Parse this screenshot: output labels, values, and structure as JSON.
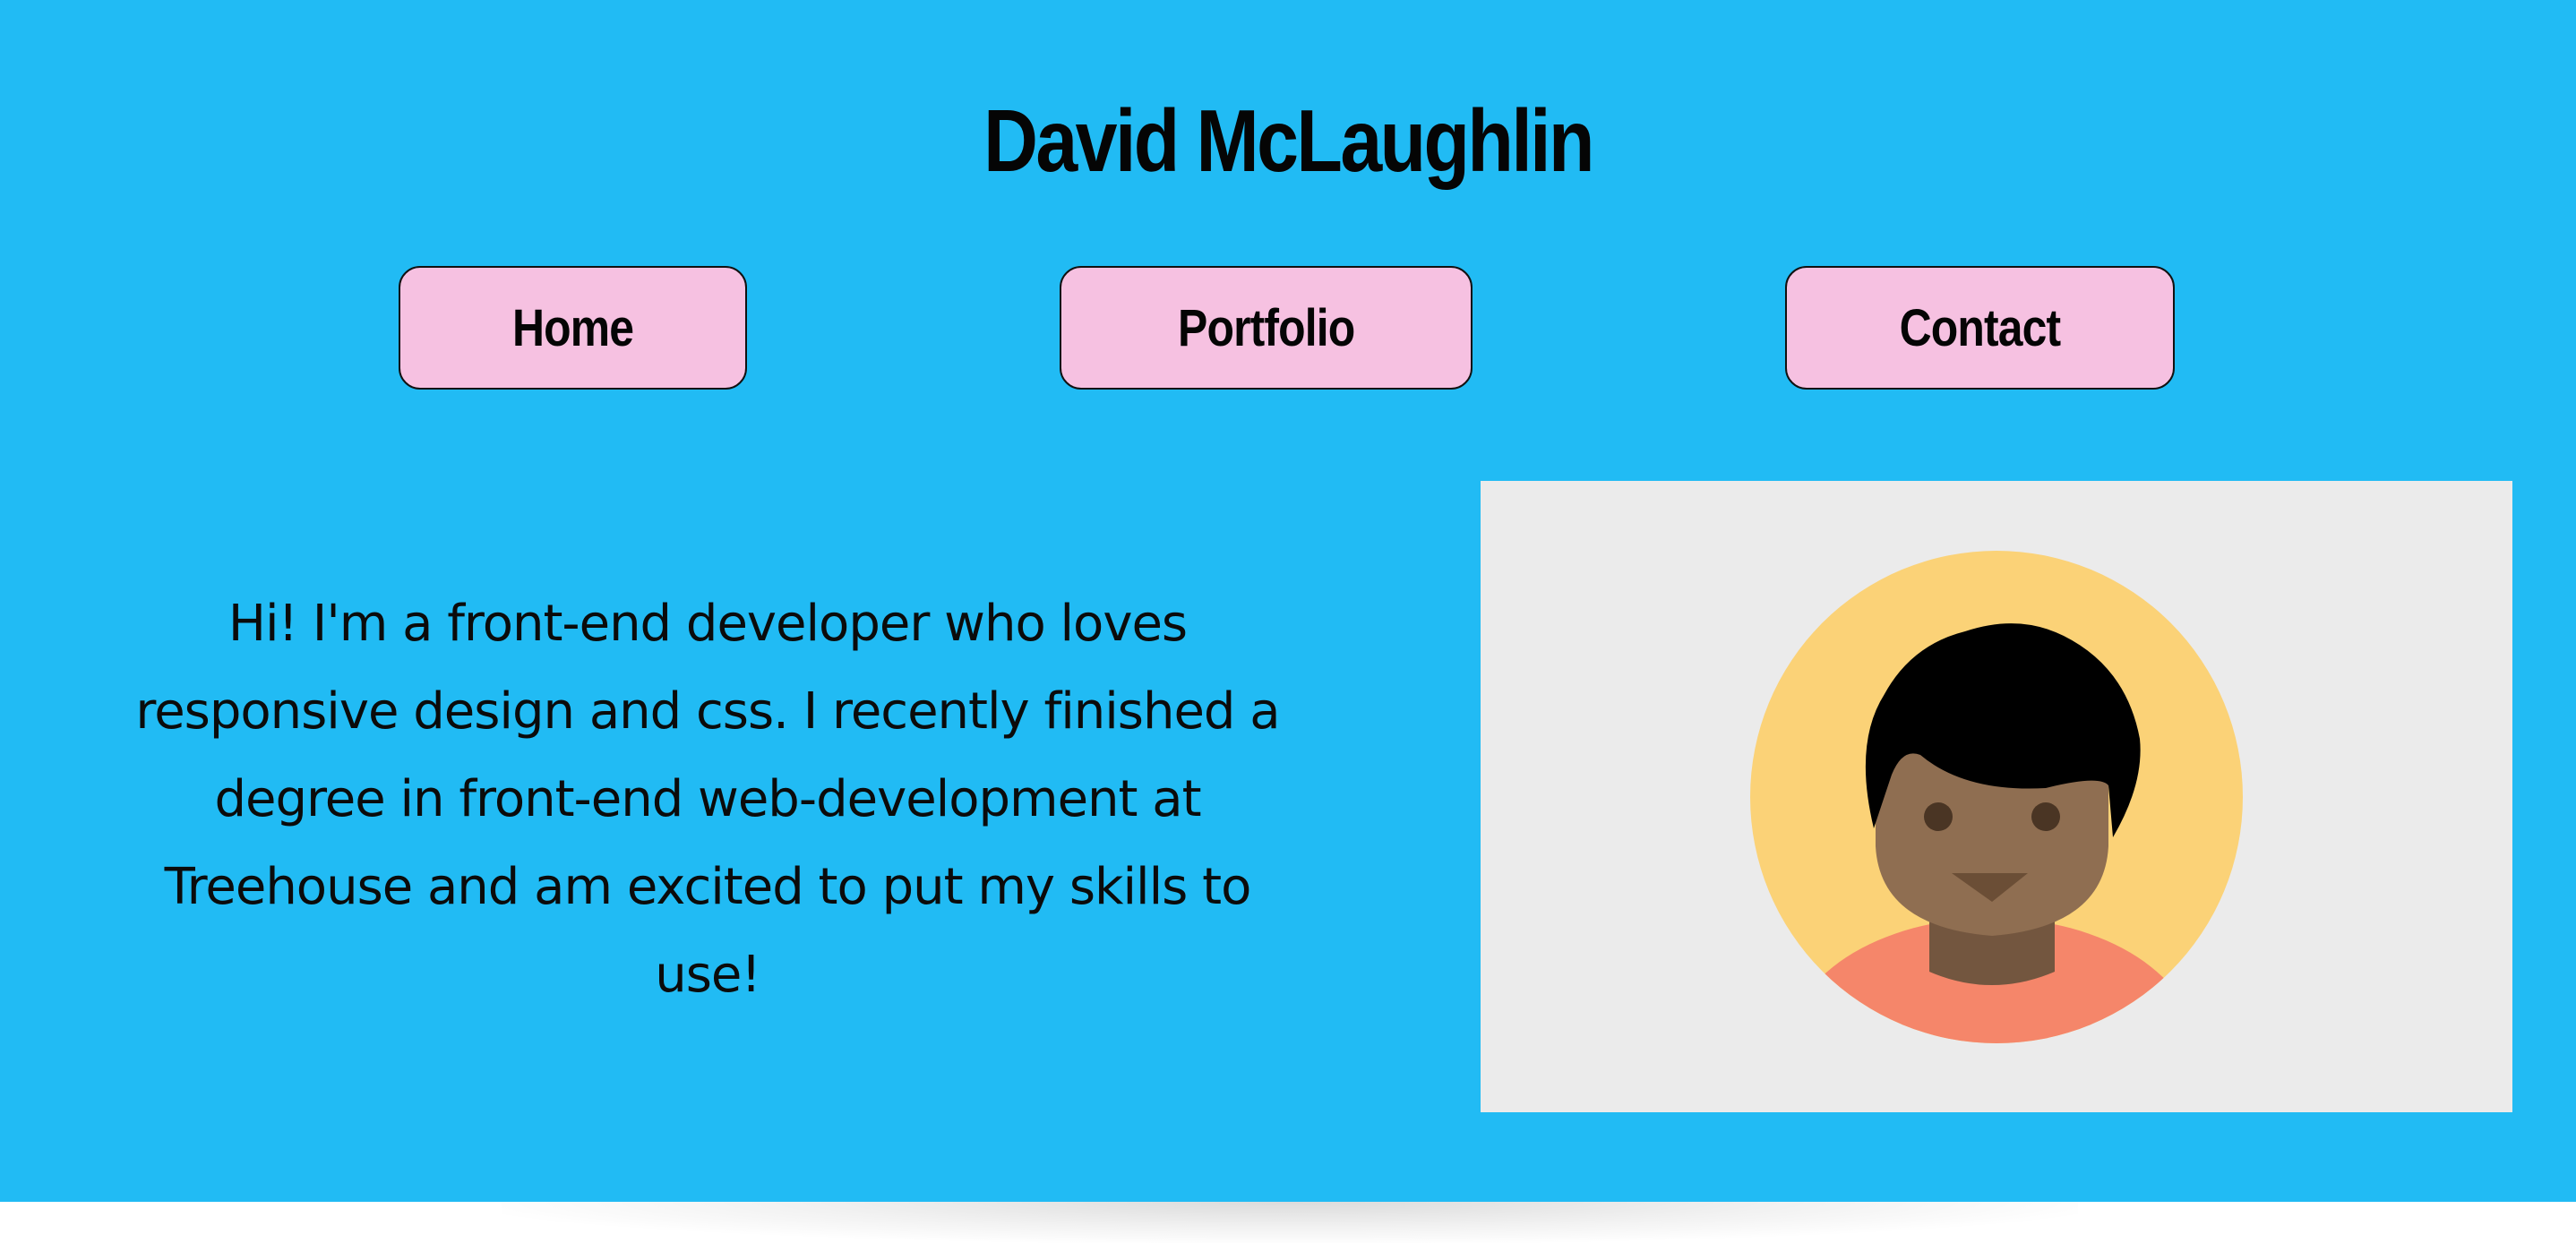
{
  "header": {
    "title": "David McLaughlin"
  },
  "nav": {
    "items": [
      {
        "label": "Home"
      },
      {
        "label": "Portfolio"
      },
      {
        "label": "Contact"
      }
    ]
  },
  "intro": {
    "text": "Hi! I'm a front-end developer who loves responsive design and css. I recently finished a degree in front-end web-development at Treehouse and am excited to put my skills to use!"
  },
  "profile_image": {
    "icon": "person-avatar-icon"
  },
  "colors": {
    "background": "#21BBF4",
    "button": "#F6C1E1",
    "photo_frame": "#EBEBEB",
    "avatar_circle": "#FBD277",
    "skin": "#8F6E51",
    "hair": "#000000",
    "shirt": "#F5866A"
  }
}
